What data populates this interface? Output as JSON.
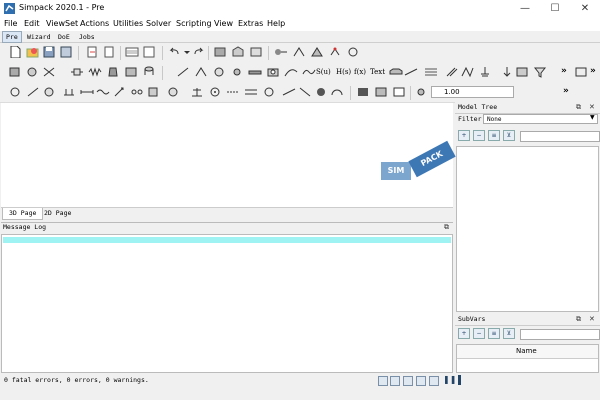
{
  "window": {
    "title": "Simpack 2020.1 - Pre",
    "minimize": "—",
    "maximize": "☐",
    "close": "✕"
  },
  "menu": [
    "File",
    "Edit",
    "ViewSet",
    "Actions",
    "Utilities",
    "Solver",
    "Scripting",
    "View",
    "Extras",
    "Help"
  ],
  "mode_tabs": [
    "Pre",
    "Wizard",
    "DoE",
    "Jobs"
  ],
  "toolbar_texts": {
    "s_u": "S(u)",
    "h_s": "H(s)",
    "f_x": "f(x)",
    "text": "Text",
    "zoom_value": "1.00"
  },
  "logo": {
    "sim": "SIM",
    "pack": "PACK"
  },
  "page_tabs": [
    "3D Page",
    "2D Page"
  ],
  "message_log": {
    "title": "Message Log"
  },
  "status": {
    "text": "0 fatal errors, 0 errors, 0 warnings."
  },
  "model_tree": {
    "title": "Model Tree",
    "filter_label": "Filter:",
    "filter_value": "None"
  },
  "subvars": {
    "title": "SubVars",
    "column_name": "Name"
  },
  "panel_icons": {
    "float": "⧉",
    "close": "✕"
  },
  "colors": {
    "accent": "#3d78b5",
    "log_highlight": "#9ff3f3"
  }
}
